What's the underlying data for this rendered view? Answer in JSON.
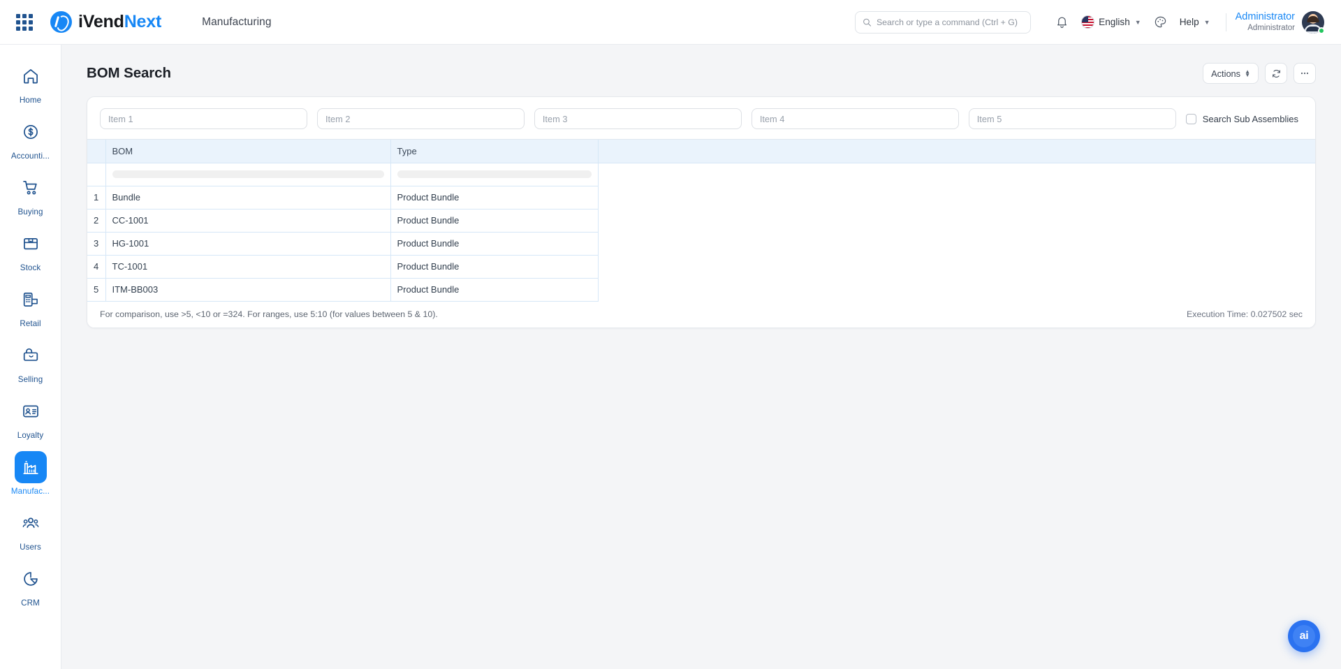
{
  "header": {
    "apps_icon": "app-grid-icon",
    "brand": {
      "first": "iVend",
      "second": "Next"
    },
    "module": "Manufacturing",
    "search": {
      "placeholder": "Search or type a command (Ctrl + G)",
      "value": "",
      "icon": "search-icon"
    },
    "notifications_icon": "bell-icon",
    "language": {
      "label": "English",
      "flag": "us-flag-icon"
    },
    "theme_icon": "palette-icon",
    "help": {
      "label": "Help"
    },
    "user": {
      "name": "Administrator",
      "role": "Administrator",
      "status": "online"
    }
  },
  "sidebar": {
    "items": [
      {
        "label": "Home",
        "icon": "home-icon",
        "active": false
      },
      {
        "label": "Accounti...",
        "icon": "dollar-circle-icon",
        "active": false
      },
      {
        "label": "Buying",
        "icon": "shopping-cart-icon",
        "active": false
      },
      {
        "label": "Stock",
        "icon": "box-icon",
        "active": false
      },
      {
        "label": "Retail",
        "icon": "pos-terminal-icon",
        "active": false
      },
      {
        "label": "Selling",
        "icon": "shopping-bag-icon",
        "active": false
      },
      {
        "label": "Loyalty",
        "icon": "id-card-icon",
        "active": false
      },
      {
        "label": "Manufac...",
        "icon": "factory-icon",
        "active": true
      },
      {
        "label": "Users",
        "icon": "users-icon",
        "active": false
      },
      {
        "label": "CRM",
        "icon": "pie-chart-icon",
        "active": false
      }
    ]
  },
  "page": {
    "title": "BOM Search",
    "actions_button": "Actions",
    "refresh_icon": "refresh-icon",
    "more_icon": "ellipsis-icon"
  },
  "filters": {
    "inputs": [
      {
        "placeholder": "Item 1",
        "value": ""
      },
      {
        "placeholder": "Item 2",
        "value": ""
      },
      {
        "placeholder": "Item 3",
        "value": ""
      },
      {
        "placeholder": "Item 4",
        "value": ""
      },
      {
        "placeholder": "Item 5",
        "value": ""
      }
    ],
    "checkbox": {
      "label": "Search Sub Assemblies",
      "checked": false
    }
  },
  "table": {
    "columns": [
      "BOM",
      "Type"
    ],
    "rows": [
      {
        "idx": "1",
        "bom": "Bundle",
        "type": "Product Bundle"
      },
      {
        "idx": "2",
        "bom": "CC-1001",
        "type": "Product Bundle"
      },
      {
        "idx": "3",
        "bom": "HG-1001",
        "type": "Product Bundle"
      },
      {
        "idx": "4",
        "bom": "TC-1001",
        "type": "Product Bundle"
      },
      {
        "idx": "5",
        "bom": "ITM-BB003",
        "type": "Product Bundle"
      }
    ]
  },
  "footer": {
    "hint": "For comparison, use >5, <10 or =324. For ranges, use 5:10 (for values between 5 & 10).",
    "execution_time": "Execution Time: 0.027502 sec"
  },
  "fab": {
    "label": "ai"
  },
  "colors": {
    "accent": "#1787f5",
    "sidebar_text": "#20538f",
    "table_header_bg": "#eaf3fc",
    "table_border": "#d6e7f7",
    "page_bg": "#f4f5f7",
    "status_online": "#22c55e",
    "fab_bg": "#2b72f0"
  }
}
